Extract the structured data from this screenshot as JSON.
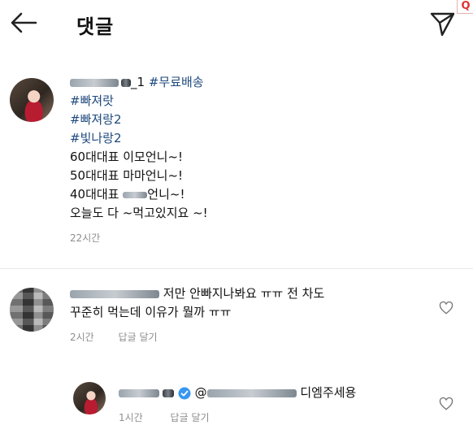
{
  "header": {
    "title": "댓글",
    "back_icon": "arrow-left-icon",
    "send_icon": "paper-plane-icon"
  },
  "caption": {
    "username_suffix": "_1",
    "lines": [
      "#무료배송",
      "#빠져랏",
      "#빠져랑2",
      "#빛나랑2",
      "60대대표 이모언니~!",
      "50대대표 마마언니~!",
      "40대대표",
      "언니~!",
      "오늘도 다 ~먹고있지요 ~!"
    ],
    "time": "22시간"
  },
  "comments": [
    {
      "text_line1": "저만 안빠지나봐요 ㅠㅠ 전 차도",
      "text_line2": "꾸준히 먹는데 이유가 뭘까 ㅠㅠ",
      "time": "2시간",
      "reply_label": "답글 달기"
    },
    {
      "mention_prefix": "@",
      "text": "디엠주세용",
      "time": "1시간",
      "reply_label": "답글 달기"
    }
  ],
  "colors": {
    "hashtag": "#1f4a7c",
    "meta": "#8e8e8e",
    "verified": "#3897f0"
  }
}
